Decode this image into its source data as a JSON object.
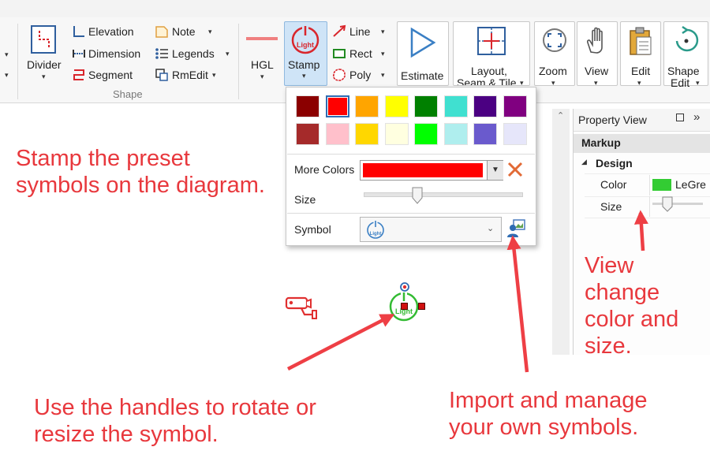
{
  "ribbon": {
    "shape_group_label": "Shape",
    "divider": "Divider",
    "elevation": "Elevation",
    "dimension": "Dimension",
    "segment": "Segment",
    "note": "Note",
    "legends": "Legends",
    "rmedit": "RmEdit",
    "hgl": "HGL",
    "stamp": "Stamp",
    "line": "Line",
    "rect": "Rect",
    "poly": "Poly",
    "estimate": "Estimate",
    "layout": "Layout,",
    "layout2": "Seam & Tile",
    "zoom": "Zoom",
    "view": "View",
    "edit": "Edit",
    "shape_edit": "Shape",
    "shape_edit2": "Edit",
    "stamp_icon_text": "Light"
  },
  "popup": {
    "swatches": [
      "#8b0000",
      "#ff0000",
      "#ffa500",
      "#ffff00",
      "#008000",
      "#40e0d0",
      "#4b0082",
      "#800080",
      "#a52a2a",
      "#ffc0cb",
      "#ffd700",
      "#ffffe0",
      "#00ff00",
      "#afeeee",
      "#6a5acd",
      "#e6e6fa"
    ],
    "more_colors_label": "More Colors",
    "more_colors_value": "#ff0000",
    "size_label": "Size",
    "symbol_label": "Symbol",
    "symbol_icon_text": "Light"
  },
  "property_view": {
    "title": "Property View",
    "section": "Markup",
    "group": "Design",
    "rows": [
      {
        "name": "Color",
        "value": "LeGre",
        "swatch": "#33cc33"
      },
      {
        "name": "Size",
        "value": ""
      }
    ]
  },
  "canvas": {
    "light_symbol_text": "Light"
  },
  "annotations": {
    "stamp_note": [
      "Stamp the preset",
      "symbols on the diagram."
    ],
    "view_note": [
      "View",
      "change",
      "color and",
      "size."
    ],
    "handles_note": [
      "Use the handles to rotate or",
      "resize the symbol."
    ],
    "import_note": [
      "Import and manage",
      "your own symbols."
    ]
  },
  "colors": {
    "annotation": "#e8383d",
    "ribbon_bg": "#f7f7f7",
    "stamp_active": "#cfe4f7"
  }
}
